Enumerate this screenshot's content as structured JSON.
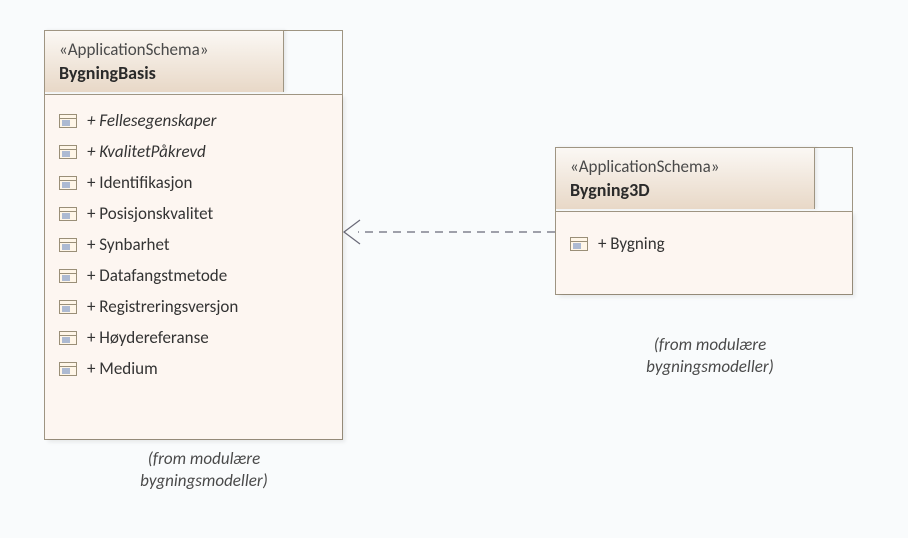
{
  "left": {
    "stereotype": "«ApplicationSchema»",
    "name": "BygningBasis",
    "items": [
      {
        "label": "+ Fellesegenskaper",
        "italic": true
      },
      {
        "label": "+ KvalitetPåkrevd",
        "italic": true
      },
      {
        "label": "+ Identifikasjon",
        "italic": false
      },
      {
        "label": "+ Posisjonskvalitet",
        "italic": false
      },
      {
        "label": "+ Synbarhet",
        "italic": false
      },
      {
        "label": "+ Datafangstmetode",
        "italic": false
      },
      {
        "label": "+ Registreringsversjon",
        "italic": false
      },
      {
        "label": "+ Høydereferanse",
        "italic": false
      },
      {
        "label": "+ Medium",
        "italic": false
      }
    ],
    "caption_l1": "(from modulære",
    "caption_l2": "bygningsmodeller)"
  },
  "right": {
    "stereotype": "«ApplicationSchema»",
    "name": "Bygning3D",
    "items": [
      {
        "label": "+ Bygning",
        "italic": false
      }
    ],
    "caption_l1": "(from modulære",
    "caption_l2": "bygningsmodeller)"
  }
}
